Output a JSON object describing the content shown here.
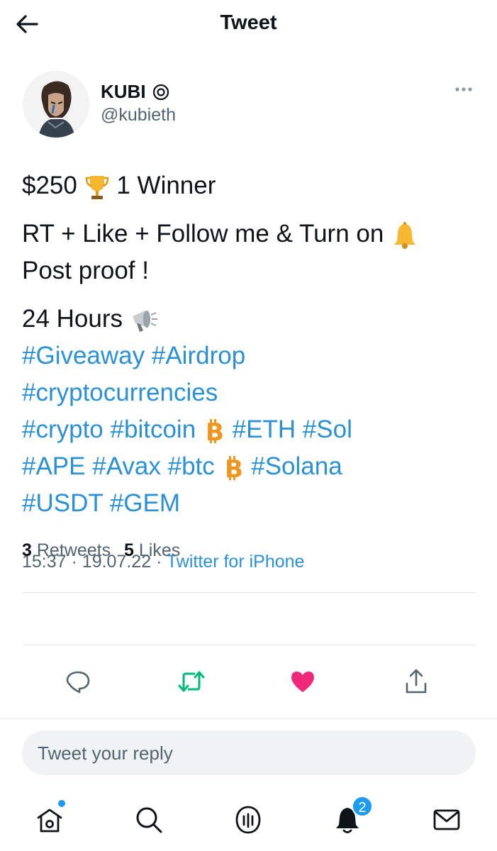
{
  "header": {
    "title": "Tweet"
  },
  "author": {
    "name": "KUBI",
    "handle": "@kubieth"
  },
  "body": {
    "l1_text1": "$250",
    "l1_text2": "1 Winner",
    "l2_text1": "RT + Like + Follow me & Turn on",
    "l3_text1": "Post proof !",
    "l4_text1": "24 Hours",
    "hashtags": {
      "giveaway": "#Giveaway",
      "airdrop": "#Airdrop",
      "cryptocurrencies": "#cryptocurrencies",
      "crypto": "#crypto",
      "bitcoin": "#bitcoin",
      "eth": "#ETH",
      "sol": "#Sol",
      "ape": "#APE",
      "avax": "#Avax",
      "btc": "#btc",
      "solana": "#Solana",
      "usdt": "#USDT",
      "gem": "#GEM"
    },
    "emoji": {
      "trophy": "trophy-icon",
      "bell": "bell-icon",
      "megaphone": "megaphone-icon",
      "bitcoin": "bitcoin-icon"
    }
  },
  "meta": {
    "time": "15:37",
    "date": "19.07.22",
    "separator": "·",
    "source": "Twitter for iPhone"
  },
  "stats": {
    "retweets_count": "3",
    "retweets_label": "Retweets",
    "likes_count": "5",
    "likes_label": "Likes"
  },
  "reply": {
    "placeholder": "Tweet your reply"
  },
  "tabbar": {
    "notifications_count": "2"
  },
  "colors": {
    "link": "#2a91d8",
    "like": "#f0287a",
    "retweet": "#00ba7c",
    "accent": "#1d9bf0",
    "secondary_text": "#536471"
  }
}
